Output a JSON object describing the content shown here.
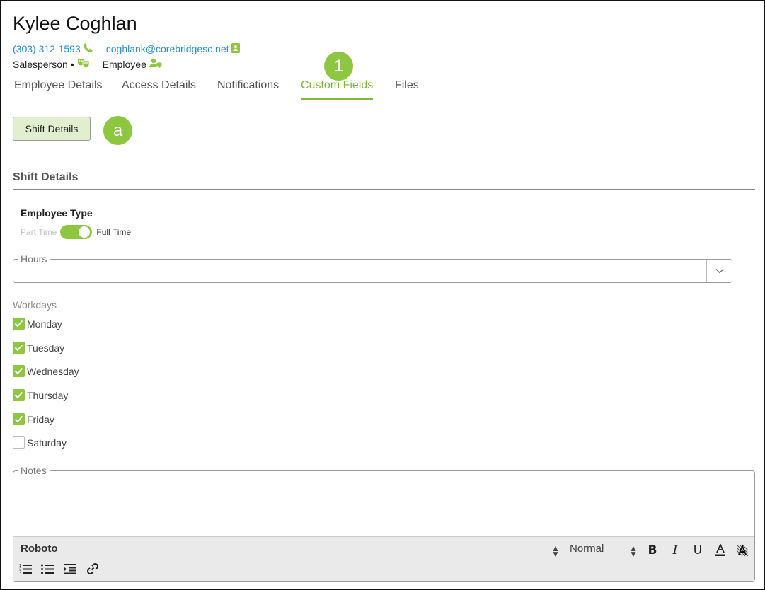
{
  "profile": {
    "name": "Kylee Coghlan",
    "phone": "(303) 312-1593",
    "email": "coghlank@corebridgesc.net",
    "role": "Salesperson •",
    "employee_label": "Employee"
  },
  "tabs": [
    {
      "label": "Employee Details"
    },
    {
      "label": "Access Details"
    },
    {
      "label": "Notifications"
    },
    {
      "label": "Custom Fields",
      "active": true
    },
    {
      "label": "Files"
    }
  ],
  "badges": {
    "tab_marker": "1",
    "button_marker": "a"
  },
  "shift_button": {
    "label": "Shift Details"
  },
  "section": {
    "title": "Shift Details"
  },
  "employee_type": {
    "label": "Employee Type",
    "off_label": "Part Time",
    "on_label": "Full Time",
    "value": "Full Time"
  },
  "hours": {
    "legend": "Hours",
    "value": ""
  },
  "workdays": {
    "label": "Workdays",
    "days": [
      {
        "label": "Monday",
        "checked": true
      },
      {
        "label": "Tuesday",
        "checked": true
      },
      {
        "label": "Wednesday",
        "checked": true
      },
      {
        "label": "Thursday",
        "checked": true
      },
      {
        "label": "Friday",
        "checked": true
      },
      {
        "label": "Saturday",
        "checked": false
      }
    ]
  },
  "notes": {
    "legend": "Notes",
    "font": "Roboto",
    "size": "Normal"
  },
  "colors": {
    "accent": "#8dc63f",
    "link": "#2a8fc8",
    "active_tab": "#7fb83b",
    "button_bg": "#e1efcf"
  },
  "icons": [
    "phone-icon",
    "contact-card-icon",
    "theater-masks-icon",
    "user-shield-icon",
    "chevron-down-icon",
    "checkmark-icon",
    "bold-icon",
    "italic-icon",
    "underline-icon",
    "font-color-icon",
    "highlight-icon",
    "ordered-list-icon",
    "bullet-list-icon",
    "indent-icon",
    "link-icon"
  ]
}
